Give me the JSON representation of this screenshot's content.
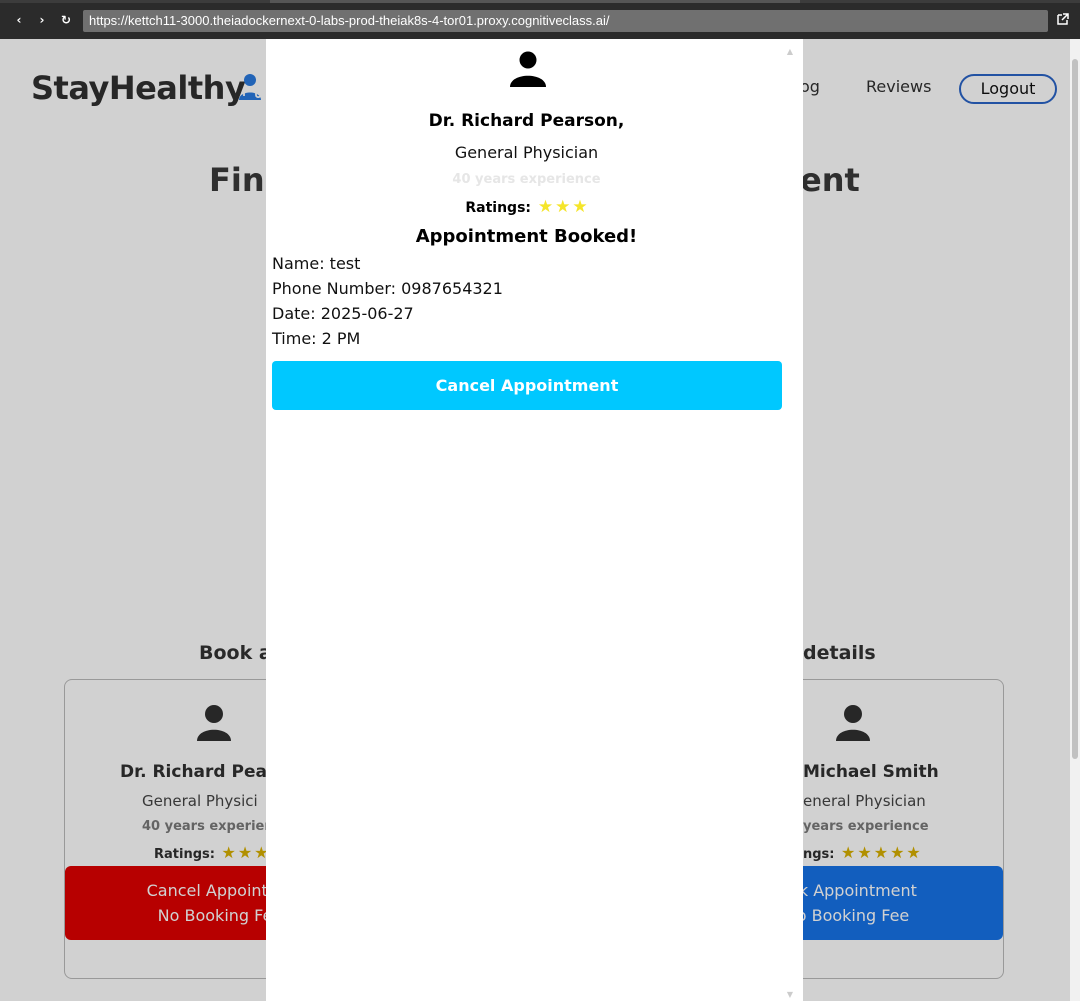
{
  "browser": {
    "url": "https://kettch11-3000.theiadockernext-0-labs-prod-theiak8s-4-tor01.proxy.cognitiveclass.ai/",
    "back_glyph": "‹",
    "forward_glyph": "›",
    "reload_glyph": "↻"
  },
  "header": {
    "brand": "StayHealthy",
    "nav_blog_partial": "og",
    "nav_reviews": "Reviews",
    "logout": "Logout"
  },
  "hero": {
    "title_left": "Fin",
    "title_right": "ent"
  },
  "section": {
    "left_title_partial": "Book ap",
    "right_title_partial": "details"
  },
  "cards": {
    "left": {
      "name": "Dr. Richard Pear",
      "speciality": "General Physici",
      "experience": "40 years experien",
      "ratings_label": "Ratings:",
      "button_line1": "Cancel Appointm",
      "button_line2": "No Booking Fe"
    },
    "right": {
      "name": "Michael Smith",
      "speciality": "eneral Physician",
      "experience": "years experience",
      "ratings_label": "ngs:",
      "button_line1": "ok Appointment",
      "button_line2": "o Booking Fee"
    }
  },
  "modal": {
    "doctor_name": "Dr. Richard Pearson,",
    "speciality": "General Physician",
    "experience": "40 years experience",
    "ratings_label": "Ratings:",
    "status": "Appointment Booked!",
    "name_line": "Name: test",
    "phone_line": "Phone Number: 0987654321",
    "date_line": "Date: 2025-06-27",
    "time_line": "Time: 2 PM",
    "cancel_button": "Cancel Appointment"
  },
  "colors": {
    "cancel_red": "#e00000",
    "book_blue": "#1673e8",
    "modal_cancel": "#00c8ff",
    "logout_border": "#2a64c7",
    "star_yellow": "#f5e52a"
  }
}
